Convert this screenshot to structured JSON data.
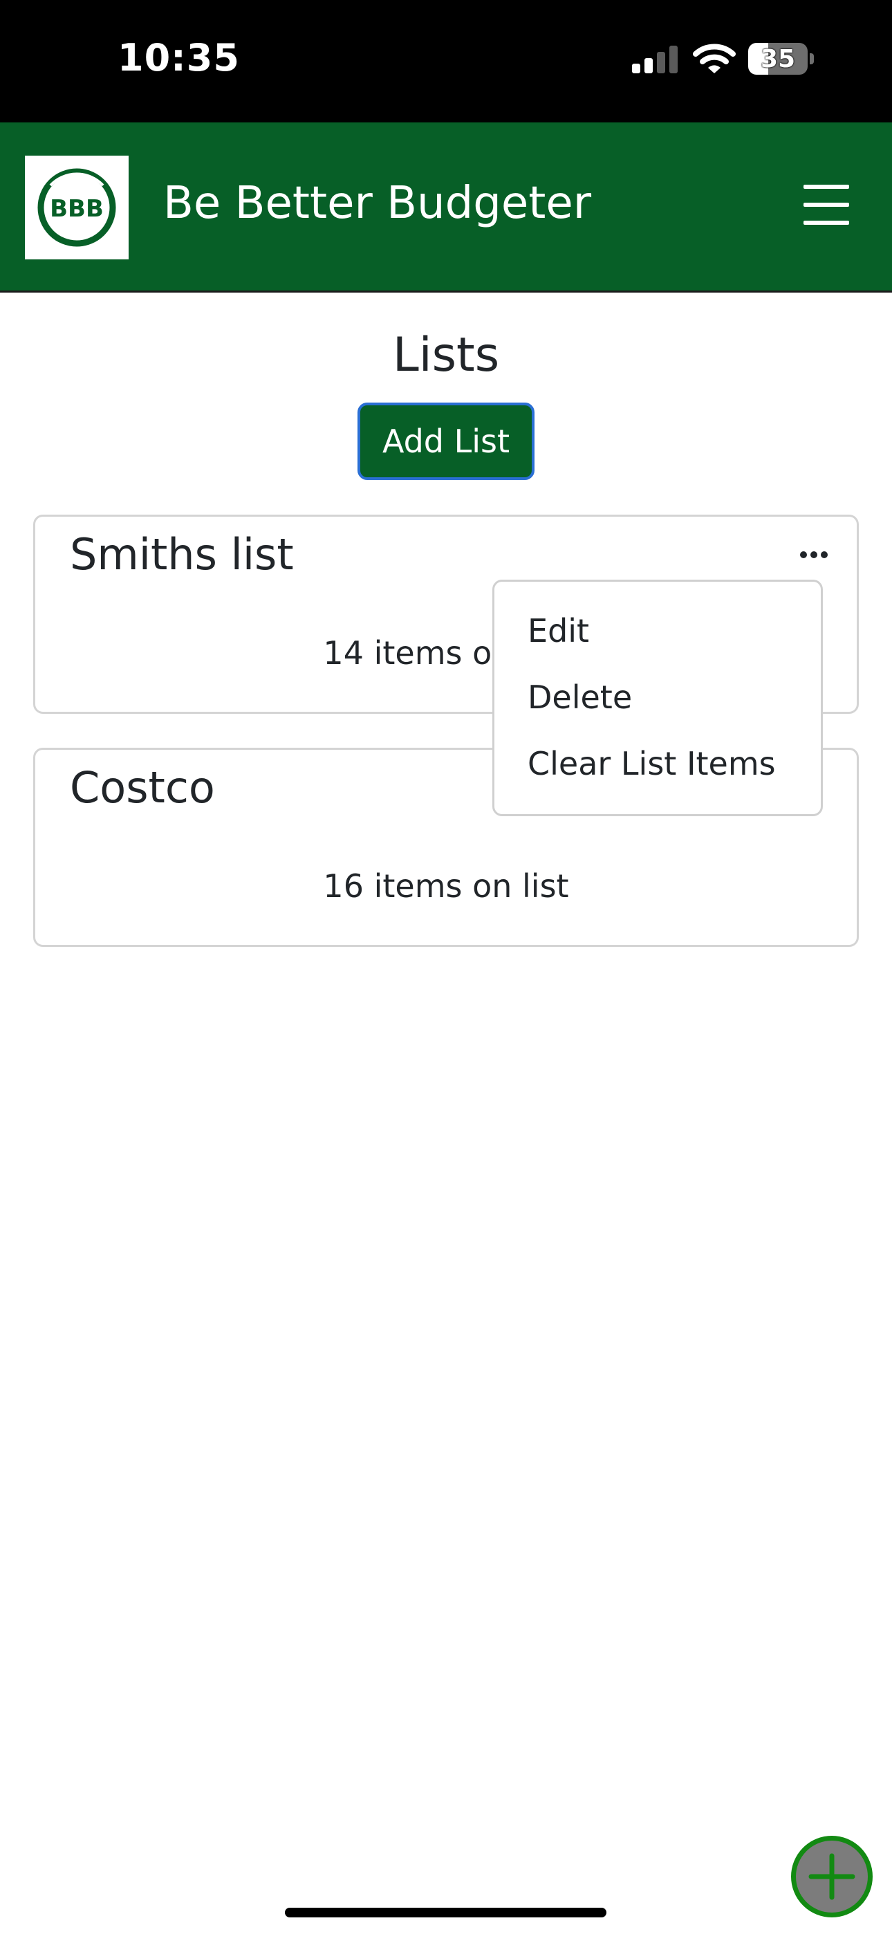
{
  "status_bar": {
    "time": "10:35",
    "battery_level": "35"
  },
  "header": {
    "logo_text": "BBB",
    "app_title": "Be Better Budgeter",
    "menu_icon": "hamburger-icon"
  },
  "page": {
    "title": "Lists",
    "add_button_label": "Add List"
  },
  "lists": [
    {
      "name": "Smiths list",
      "count_text": "14 items on list"
    },
    {
      "name": "Costco",
      "count_text": "16 items on list"
    }
  ],
  "dropdown": {
    "items": [
      "Edit",
      "Delete",
      "Clear List Items"
    ]
  },
  "fab": {
    "icon": "plus-icon"
  },
  "colors": {
    "brand_green": "#075f27",
    "fab_border": "#128a12",
    "fab_fill": "#7c7c7c"
  }
}
